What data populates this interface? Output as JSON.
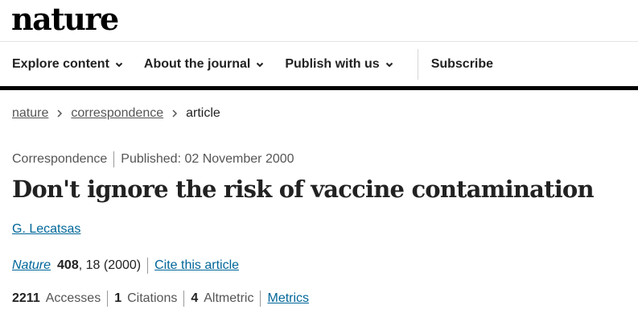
{
  "site": {
    "logo": "nature"
  },
  "nav": {
    "items": [
      {
        "label": "Explore content"
      },
      {
        "label": "About the journal"
      },
      {
        "label": "Publish with us"
      }
    ],
    "subscribe": "Subscribe"
  },
  "breadcrumb": {
    "home": "nature",
    "section": "correspondence",
    "current": "article"
  },
  "article": {
    "type": "Correspondence",
    "published": "Published: 02 November 2000",
    "title": "Don't ignore the risk of vaccine contamination",
    "author": "G. Lecatsas",
    "journal": "Nature",
    "volume": "408",
    "pages_year": ", 18 (2000)",
    "cite_link": "Cite this article"
  },
  "metrics": {
    "accesses_count": "2211",
    "accesses_label": "Accesses",
    "citations_count": "1",
    "citations_label": "Citations",
    "altmetric_count": "4",
    "altmetric_label": "Altmetric",
    "metrics_link": "Metrics"
  },
  "colors": {
    "link": "#006699",
    "text": "#222222",
    "muted": "#555555"
  }
}
